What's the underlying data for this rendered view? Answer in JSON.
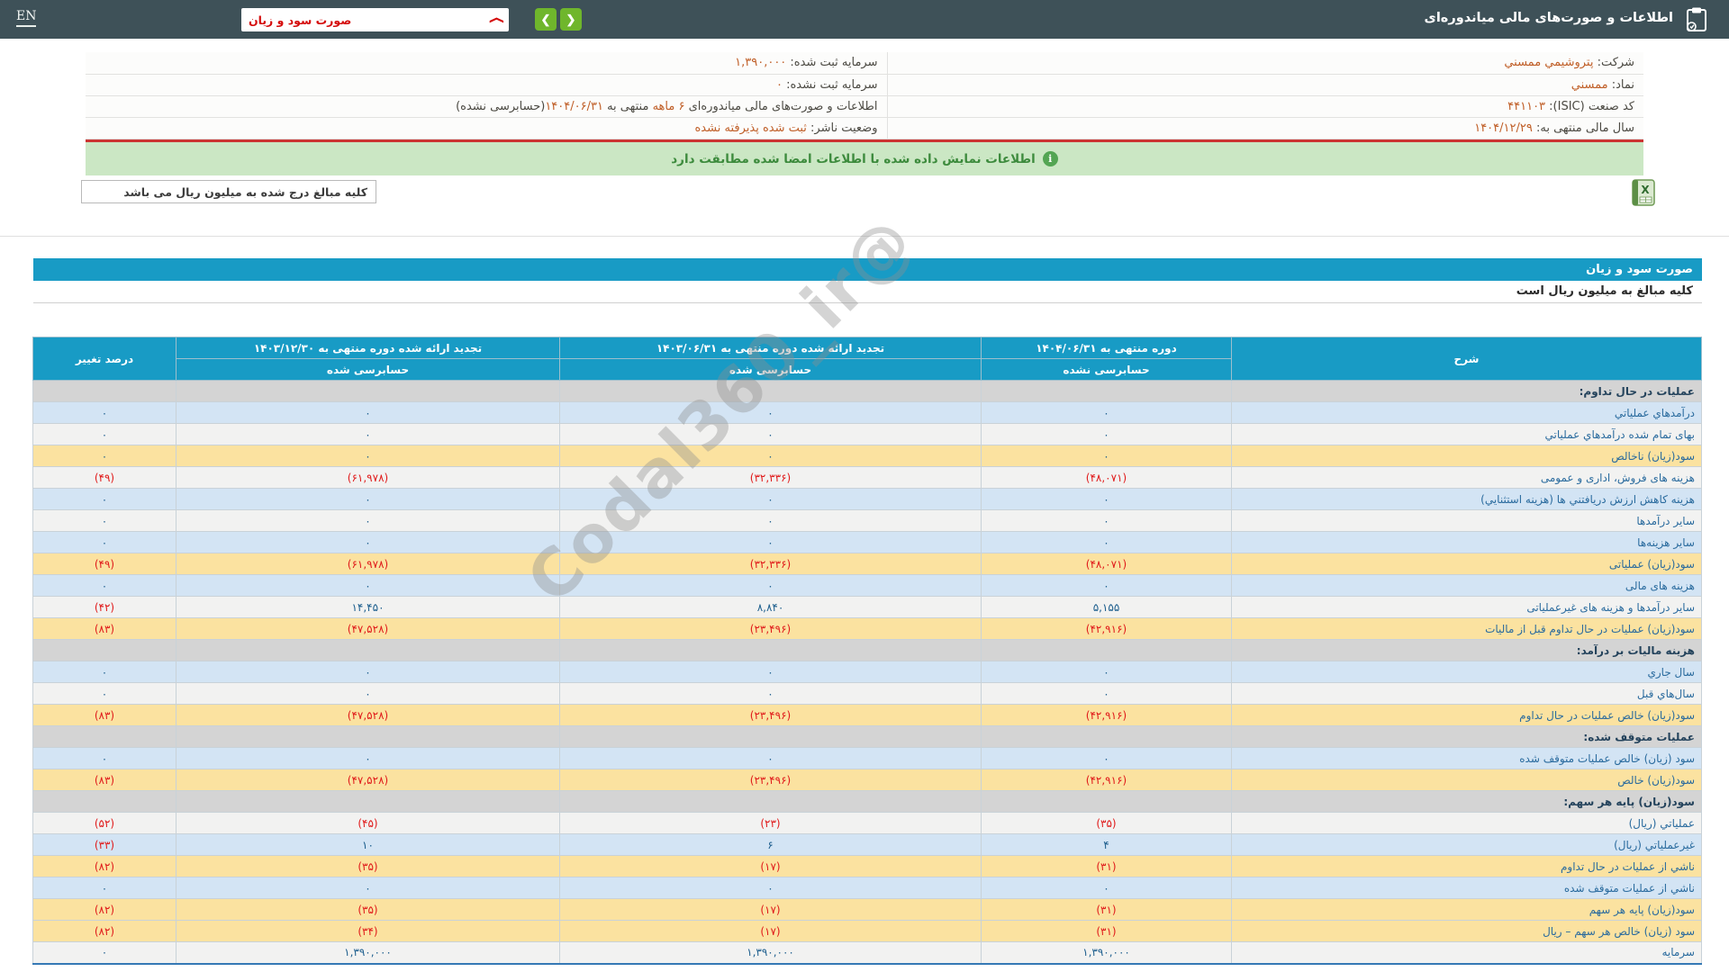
{
  "topbar": {
    "title": "اطلاعات و صورت‌های مالی میاندوره‌ای",
    "dropdown_value": "صورت سود و زیان",
    "lang_toggle": "EN",
    "prev_label": "❮",
    "next_label": "❯"
  },
  "company_info": {
    "right": [
      {
        "label": "شرکت:",
        "value": "پتروشیمي ممسني"
      },
      {
        "label": "نماد:",
        "value": "ممسني"
      },
      {
        "label": "کد صنعت (ISIC):",
        "value": "۴۴۱۱۰۳"
      },
      {
        "label": "سال مالی منتهی به:",
        "value": "۱۴۰۴/۱۲/۲۹"
      }
    ],
    "left": [
      {
        "label": "سرمایه ثبت شده:",
        "value": "۱,۳۹۰,۰۰۰"
      },
      {
        "label": "سرمایه ثبت نشده:",
        "value": "۰"
      },
      {
        "segments": [
          {
            "text": "اطلاعات و صورت‌های مالی میاندوره‌ای "
          },
          {
            "text": "۶ ماهه",
            "hl": true
          },
          {
            "text": " منتهی به "
          },
          {
            "text": "۱۴۰۴/۰۶/۳۱",
            "hl": true
          },
          {
            "text": "(حسابرسی نشده)"
          }
        ]
      },
      {
        "label": "وضعیت ناشر:",
        "value": "ثبت شده پذیرفته نشده"
      }
    ]
  },
  "banner": {
    "text": "اطلاعات نمایش داده شده با اطلاعات امضا شده مطابقت دارد",
    "info_icon": "i"
  },
  "amounts_note": "کلیه مبالغ درج شده به میلیون ریال می باشد",
  "statement": {
    "title": "صورت سود و زیان",
    "note": "کلیه مبالغ به میلیون ریال است"
  },
  "table": {
    "desc_header": "شرح",
    "pct_header": "درصد تغییر",
    "col_headers": [
      {
        "line1": "دوره منتهی به ۱۴۰۴/۰۶/۳۱",
        "line2": "حسابرسی نشده"
      },
      {
        "line1": "تجدید ارائه شده دوره منتهی به ۱۴۰۳/۰۶/۳۱",
        "line2": "حسابرسی شده"
      },
      {
        "line1": "تجدید ارائه شده دوره منتهی به ۱۴۰۳/۱۲/۳۰",
        "line2": "حسابرسی شده"
      }
    ],
    "rows": [
      {
        "type": "section",
        "label": "عملیات در حال تداوم:",
        "c1": "",
        "c2": "",
        "c3": "",
        "pct": ""
      },
      {
        "type": "blue",
        "label": "درآمدهاي عملیاتي",
        "c1": "۰",
        "c2": "۰",
        "c3": "۰",
        "pct": "۰"
      },
      {
        "type": "plain",
        "label": "بهای تمام شده درآمدهاي عملیاتي",
        "c1": "۰",
        "c2": "۰",
        "c3": "۰",
        "pct": "۰"
      },
      {
        "type": "yellow",
        "label": "سود(زیان) ناخالص",
        "c1": "۰",
        "c2": "۰",
        "c3": "۰",
        "pct": "۰"
      },
      {
        "type": "plain",
        "label": "هزینه های فروش، اداری و عمومی",
        "c1": "(۴۸,۰۷۱)",
        "c2": "(۳۲,۳۳۶)",
        "c3": "(۶۱,۹۷۸)",
        "pct": "(۴۹)"
      },
      {
        "type": "blue",
        "label": "هزینه کاهش ارزش دریافتني ها (هزینه استثنایي)",
        "c1": "۰",
        "c2": "۰",
        "c3": "۰",
        "pct": "۰"
      },
      {
        "type": "plain",
        "label": "سایر درآمدها",
        "c1": "۰",
        "c2": "۰",
        "c3": "۰",
        "pct": "۰"
      },
      {
        "type": "blue",
        "label": "سایر هزینه‌ها",
        "c1": "۰",
        "c2": "۰",
        "c3": "۰",
        "pct": "۰"
      },
      {
        "type": "yellow",
        "label": "سود(زیان) عملیاتی",
        "c1": "(۴۸,۰۷۱)",
        "c2": "(۳۲,۳۳۶)",
        "c3": "(۶۱,۹۷۸)",
        "pct": "(۴۹)"
      },
      {
        "type": "blue",
        "label": "هزینه های مالی",
        "c1": "۰",
        "c2": "۰",
        "c3": "۰",
        "pct": "۰"
      },
      {
        "type": "plain",
        "label": "سایر درآمدها و هزینه های غیرعملیاتی",
        "c1": "۵,۱۵۵",
        "c2": "۸,۸۴۰",
        "c3": "۱۴,۴۵۰",
        "pct": "(۴۲)"
      },
      {
        "type": "yellow",
        "label": "سود(زیان) عملیات در حال تداوم قبل از مالیات",
        "c1": "(۴۲,۹۱۶)",
        "c2": "(۲۳,۴۹۶)",
        "c3": "(۴۷,۵۲۸)",
        "pct": "(۸۳)"
      },
      {
        "type": "section",
        "label": "هزینه مالیات بر درآمد:",
        "c1": "",
        "c2": "",
        "c3": "",
        "pct": ""
      },
      {
        "type": "blue",
        "label": "سال جاري",
        "c1": "۰",
        "c2": "۰",
        "c3": "۰",
        "pct": "۰"
      },
      {
        "type": "plain",
        "label": "سال‌هاي قبل",
        "c1": "۰",
        "c2": "۰",
        "c3": "۰",
        "pct": "۰"
      },
      {
        "type": "yellow",
        "label": "سود(زیان) خالص عملیات در حال تداوم",
        "c1": "(۴۲,۹۱۶)",
        "c2": "(۲۳,۴۹۶)",
        "c3": "(۴۷,۵۲۸)",
        "pct": "(۸۳)"
      },
      {
        "type": "section",
        "label": "عملیات متوقف شده:",
        "c1": "",
        "c2": "",
        "c3": "",
        "pct": ""
      },
      {
        "type": "blue",
        "label": "سود (زیان) خالص عملیات متوقف شده",
        "c1": "۰",
        "c2": "۰",
        "c3": "۰",
        "pct": "۰"
      },
      {
        "type": "yellow",
        "label": "سود(زیان) خالص",
        "c1": "(۴۲,۹۱۶)",
        "c2": "(۲۳,۴۹۶)",
        "c3": "(۴۷,۵۲۸)",
        "pct": "(۸۳)"
      },
      {
        "type": "section",
        "label": "سود(زیان) پایه هر سهم:",
        "c1": "",
        "c2": "",
        "c3": "",
        "pct": ""
      },
      {
        "type": "plain",
        "label": "عملیاتي (ریال)",
        "c1": "(۳۵)",
        "c2": "(۲۳)",
        "c3": "(۴۵)",
        "pct": "(۵۲)"
      },
      {
        "type": "blue",
        "label": "غیرعملیاتي (ریال)",
        "c1": "۴",
        "c2": "۶",
        "c3": "۱۰",
        "pct": "(۳۳)"
      },
      {
        "type": "yellow",
        "label": "ناشي از عملیات در حال تداوم",
        "c1": "(۳۱)",
        "c2": "(۱۷)",
        "c3": "(۳۵)",
        "pct": "(۸۲)"
      },
      {
        "type": "blue",
        "label": "ناشي از عملیات متوقف شده",
        "c1": "۰",
        "c2": "۰",
        "c3": "۰",
        "pct": "۰"
      },
      {
        "type": "yellow",
        "label": "سود(زیان) پایه هر سهم",
        "c1": "(۳۱)",
        "c2": "(۱۷)",
        "c3": "(۳۵)",
        "pct": "(۸۲)"
      },
      {
        "type": "yellow",
        "label": "سود (زیان) خالص هر سهم – ریال",
        "c1": "(۳۱)",
        "c2": "(۱۷)",
        "c3": "(۳۴)",
        "pct": "(۸۲)"
      },
      {
        "type": "plain",
        "label": "سرمایه",
        "c1": "۱,۳۹۰,۰۰۰",
        "c2": "۱,۳۹۰,۰۰۰",
        "c3": "۱,۳۹۰,۰۰۰",
        "pct": "۰"
      }
    ]
  },
  "watermark": "@Codal360_ir",
  "colors": {
    "topbar": "#3e5158",
    "teal_header": "#189bc5",
    "row_blue": "#d3e4f4",
    "row_yellow": "#fbe2a0",
    "row_section_gray": "#d4d4d4",
    "negative_red": "#e01b1b",
    "value_orange": "#c05f28",
    "banner_green_bg": "#cbe7c4",
    "banner_green_text": "#3d8b3d",
    "red_divider": "#cc3432",
    "nav_green": "#6fb62c"
  }
}
